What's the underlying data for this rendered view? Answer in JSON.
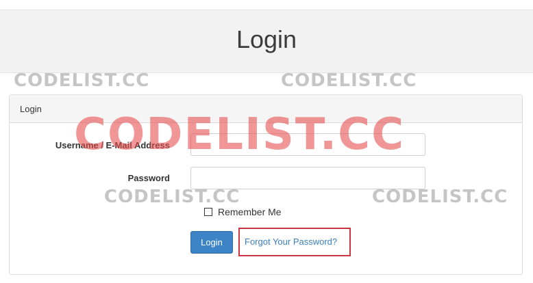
{
  "page": {
    "title": "Login"
  },
  "panel": {
    "heading": "Login"
  },
  "form": {
    "username_label": "Username / E-Mail Address",
    "username_value": "",
    "password_label": "Password",
    "password_value": "",
    "remember_label": "Remember Me",
    "remember_checked": false,
    "login_button": "Login",
    "forgot_link": "Forgot Your Password?"
  },
  "watermark": {
    "text": "CODELIST.CC"
  },
  "colors": {
    "primary_button": "#3c84c6",
    "link": "#3a80c0",
    "highlight_border": "#c8343f",
    "watermark_red": "#e85050",
    "watermark_gray": "#969696"
  }
}
